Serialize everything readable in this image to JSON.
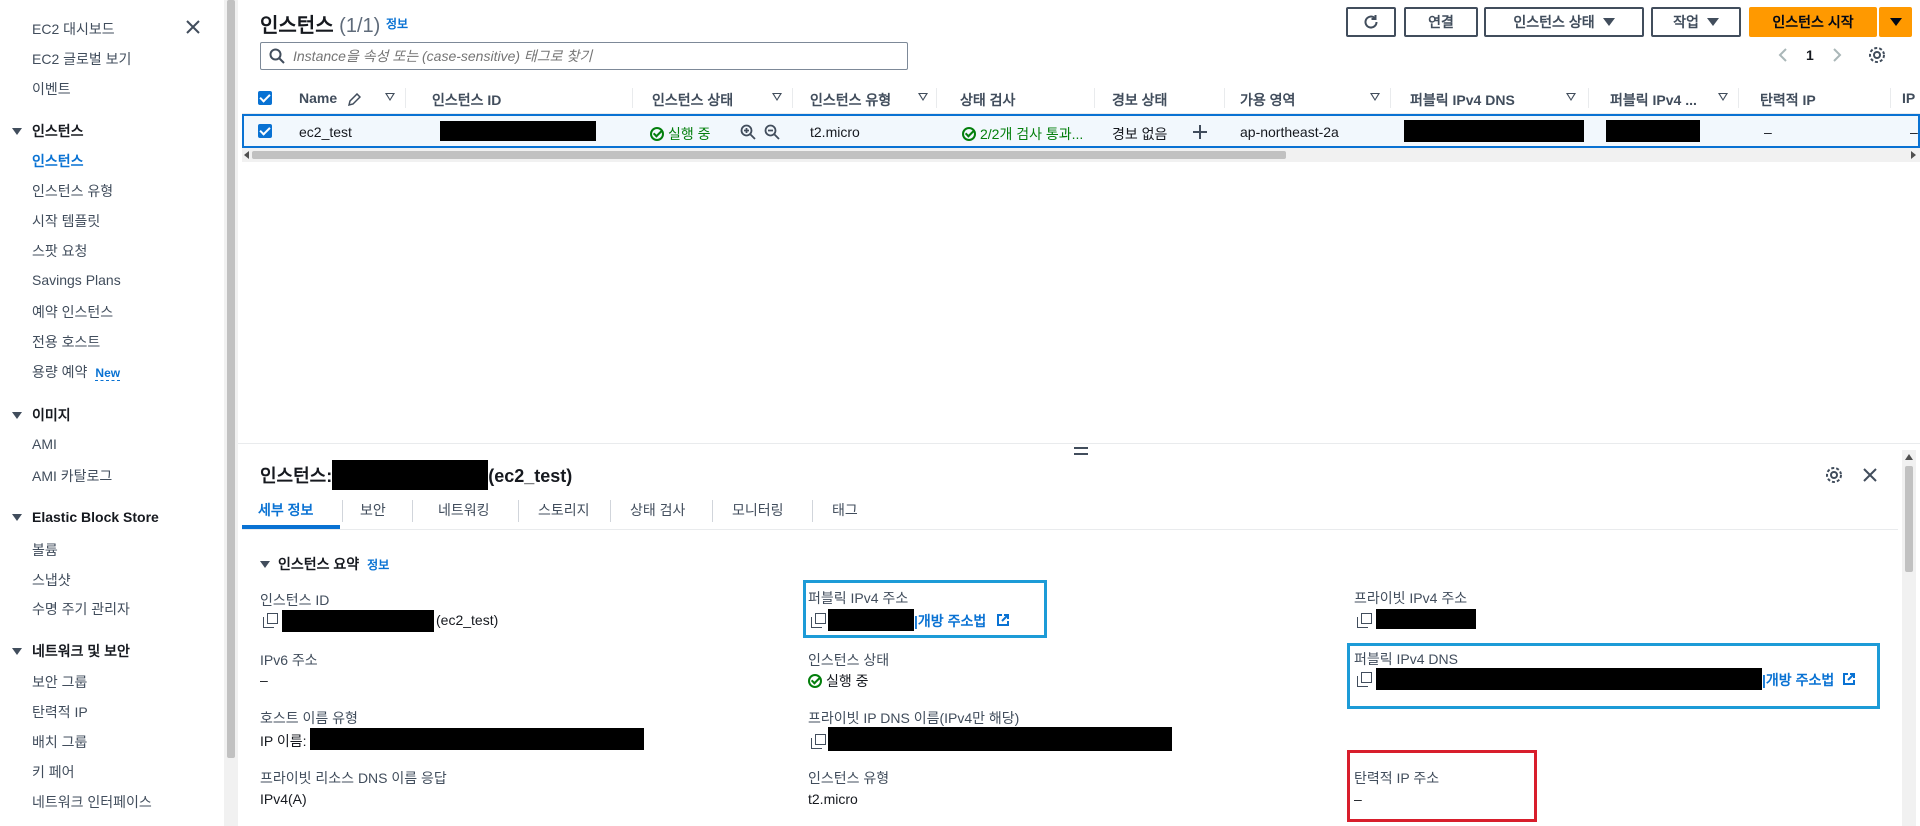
{
  "sidebar": {
    "top_items": [
      "EC2 대시보드",
      "EC2 글로벌 보기",
      "이벤트"
    ],
    "groups": [
      {
        "title": "인스턴스",
        "items": [
          "인스턴스",
          "인스턴스 유형",
          "시작 템플릿",
          "스팟 요청",
          "Savings Plans",
          "예약 인스턴스",
          "전용 호스트",
          "용량 예약"
        ]
      },
      {
        "title": "이미지",
        "items": [
          "AMI",
          "AMI 카탈로그"
        ]
      },
      {
        "title": "Elastic Block Store",
        "items": [
          "볼륨",
          "스냅샷",
          "수명 주기 관리자"
        ]
      },
      {
        "title": "네트워크 및 보안",
        "items": [
          "보안 그룹",
          "탄력적 IP",
          "배치 그룹",
          "키 페어",
          "네트워크 인터페이스"
        ]
      }
    ],
    "new_badge": "New"
  },
  "header": {
    "title": "인스턴스",
    "count": "(1/1)",
    "info": "정보",
    "buttons": {
      "connect": "연결",
      "instance_state": "인스턴스 상태",
      "actions": "작업",
      "launch": "인스턴스 시작"
    },
    "search_placeholder": "Instance을 속성 또는 (case-sensitive) 태그로 찾기",
    "page": "1"
  },
  "table": {
    "columns": [
      "Name",
      "인스턴스 ID",
      "인스턴스 상태",
      "인스턴스 유형",
      "상태 검사",
      "경보 상태",
      "가용 영역",
      "퍼블릭 IPv4 DNS",
      "퍼블릭 IPv4 ...",
      "탄력적 IP",
      "IP"
    ],
    "row": {
      "name": "ec2_test",
      "state": "실행 중",
      "type": "t2.micro",
      "status_check": "2/2개 검사 통과...",
      "alarm": "경보 없음",
      "az": "ap-northeast-2a",
      "elastic_ip": "–",
      "last": "–"
    }
  },
  "details": {
    "title_prefix": "인스턴스:",
    "title_suffix": "(ec2_test)",
    "tabs": [
      "세부 정보",
      "보안",
      "네트워킹",
      "스토리지",
      "상태 검사",
      "모니터링",
      "태그"
    ],
    "section": "인스턴스 요약",
    "section_info": "정보",
    "fields": {
      "instance_id_label": "인스턴스 ID",
      "instance_id_suffix": "(ec2_test)",
      "ipv6_label": "IPv6 주소",
      "ipv6_value": "–",
      "host_type_label": "호스트 이름 유형",
      "host_type_prefix": "IP 이름:",
      "private_dns_resp_label": "프라이빗 리소스 DNS 이름 응답",
      "private_dns_resp_value": "IPv4(A)",
      "public_ipv4_label": "퍼블릭 IPv4 주소",
      "open_address": "|개방 주소법",
      "state_label": "인스턴스 상태",
      "state_value": "실행 중",
      "private_ip_dns_label": "프라이빗 IP DNS 이름(IPv4만 해당)",
      "instance_type_label": "인스턴스 유형",
      "instance_type_value": "t2.micro",
      "private_ipv4_label": "프라이빗 IPv4 주소",
      "public_dns_label": "퍼블릭 IPv4 DNS",
      "public_dns_open": "|개방 주소법",
      "elastic_ip_label": "탄력적 IP 주소",
      "elastic_ip_value": "–"
    }
  },
  "colors": {
    "accent": "#0972d3",
    "primary": "#ff9900",
    "success": "#037f0c",
    "highlight_blue": "#1d9bd7",
    "highlight_red": "#d81e2c"
  }
}
